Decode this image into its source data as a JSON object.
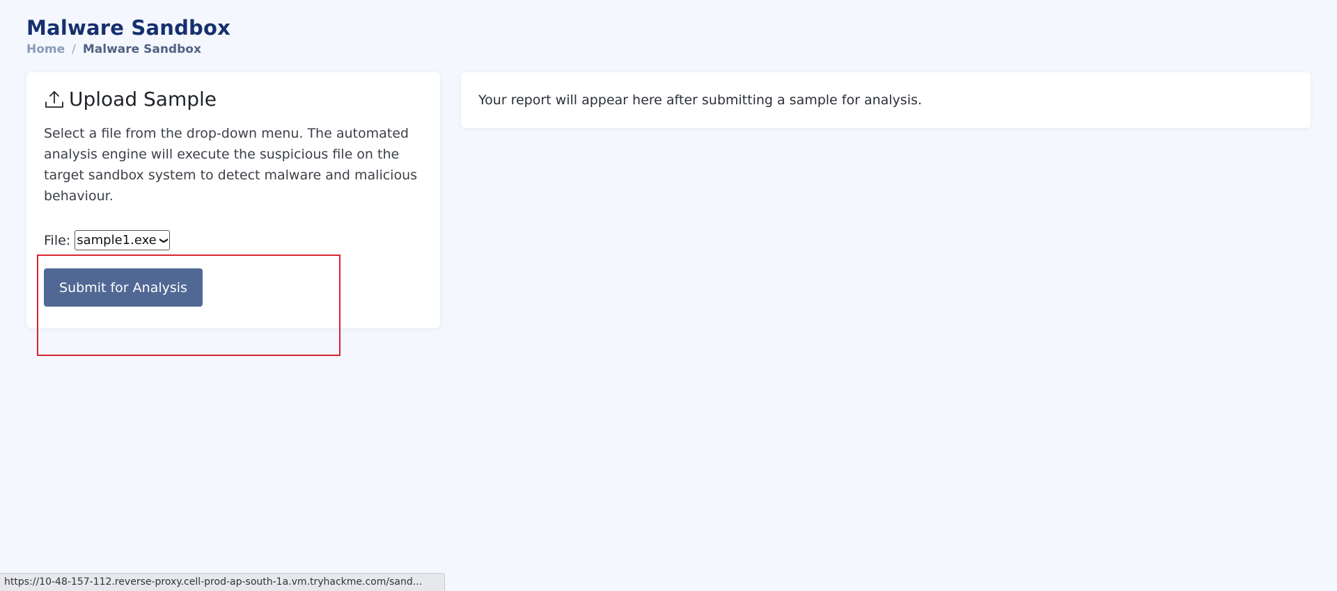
{
  "header": {
    "title": "Malware Sandbox",
    "breadcrumb": {
      "home": "Home",
      "separator": "/",
      "current": "Malware Sandbox"
    }
  },
  "upload": {
    "icon": "upload-icon",
    "title": "Upload Sample",
    "description": "Select a file from the drop-down menu. The automated analysis engine will execute the suspicious file on the target sandbox system to detect malware and malicious behaviour.",
    "file_label": "File:",
    "file_selected": "sample1.exe",
    "submit_label": "Submit for Analysis"
  },
  "report": {
    "placeholder": "Your report will appear here after submitting a sample for analysis."
  },
  "status_bar": {
    "url": "https://10-48-157-112.reverse-proxy.cell-prod-ap-south-1a.vm.tryhackme.com/sand..."
  },
  "colors": {
    "title": "#16306e",
    "button": "#516894",
    "highlight": "#d9232e",
    "background": "#f4f7fd"
  }
}
